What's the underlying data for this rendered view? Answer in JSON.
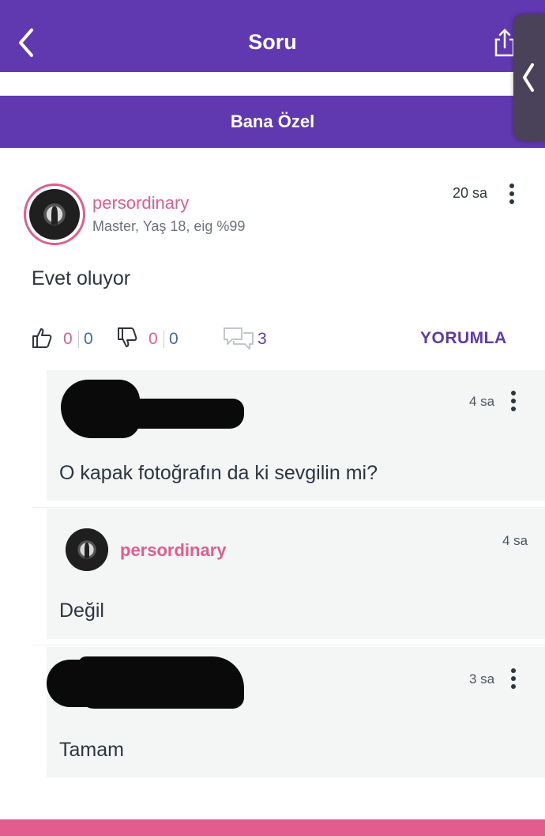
{
  "header": {
    "title": "Soru",
    "back_icon": "chevron-left-icon",
    "share_icon": "share-icon"
  },
  "subheader": {
    "label": "Bana Özel"
  },
  "answer": {
    "username": "persordinary",
    "meta": "Master, Yaş 18, eig %99",
    "time": "20 sa",
    "text": "Evet oluyor",
    "likes_a": "0",
    "likes_b": "0",
    "dislikes_a": "0",
    "dislikes_b": "0",
    "comment_count": "3",
    "reply_label": "YORUMLA"
  },
  "comments": [
    {
      "time": "4 sa",
      "text": "O kapak fotoğrafın da ki sevgilin mi?"
    },
    {
      "username": "persordinary",
      "time": "4 sa",
      "text": "Değil"
    },
    {
      "time": "3 sa",
      "text": "Tamam"
    }
  ],
  "colors": {
    "brand_purple": "#6039b0",
    "accent_pink": "#e25d8e",
    "like_blue": "#3d6bb3"
  }
}
